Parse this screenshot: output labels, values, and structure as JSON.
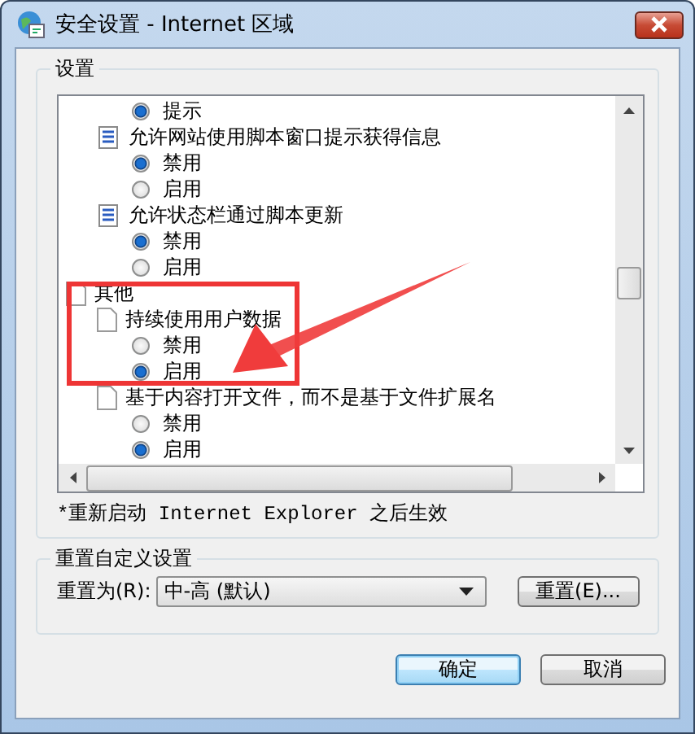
{
  "window": {
    "title": "安全设置 - Internet 区域"
  },
  "settings_group": {
    "title": "设置"
  },
  "settings": [
    {
      "children": [
        {
          "children": [
            {
              "kind": "radio",
              "label": "提示",
              "selected": true
            }
          ]
        },
        {
          "kind": "script-setting",
          "label": "允许网站使用脚本窗口提示获得信息",
          "children": [
            {
              "kind": "radio",
              "label": "禁用",
              "selected": true
            },
            {
              "kind": "radio",
              "label": "启用",
              "selected": false
            }
          ]
        },
        {
          "kind": "script-setting",
          "label": "允许状态栏通过脚本更新",
          "children": [
            {
              "kind": "radio",
              "label": "禁用",
              "selected": true
            },
            {
              "kind": "radio",
              "label": "启用",
              "selected": false
            }
          ]
        }
      ]
    },
    {
      "kind": "category",
      "label": "其他",
      "children": [
        {
          "kind": "setting",
          "label": "持续使用用户数据",
          "children": [
            {
              "kind": "radio",
              "label": "禁用",
              "selected": false
            },
            {
              "kind": "radio",
              "label": "启用",
              "selected": true
            }
          ]
        },
        {
          "kind": "setting",
          "label": "基于内容打开文件，而不是基于文件扩展名",
          "children": [
            {
              "kind": "radio",
              "label": "禁用",
              "selected": false
            },
            {
              "kind": "radio",
              "label": "启用",
              "selected": true
            }
          ]
        }
      ]
    }
  ],
  "note": "*重新启动 Internet Explorer 之后生效",
  "reset_group": {
    "title": "重置自定义设置",
    "label": "重置为(R):",
    "value": "中-高 (默认)",
    "button": "重置(E)..."
  },
  "buttons": [
    {
      "label": "确定",
      "default": true
    },
    {
      "label": "取消",
      "default": false
    }
  ]
}
